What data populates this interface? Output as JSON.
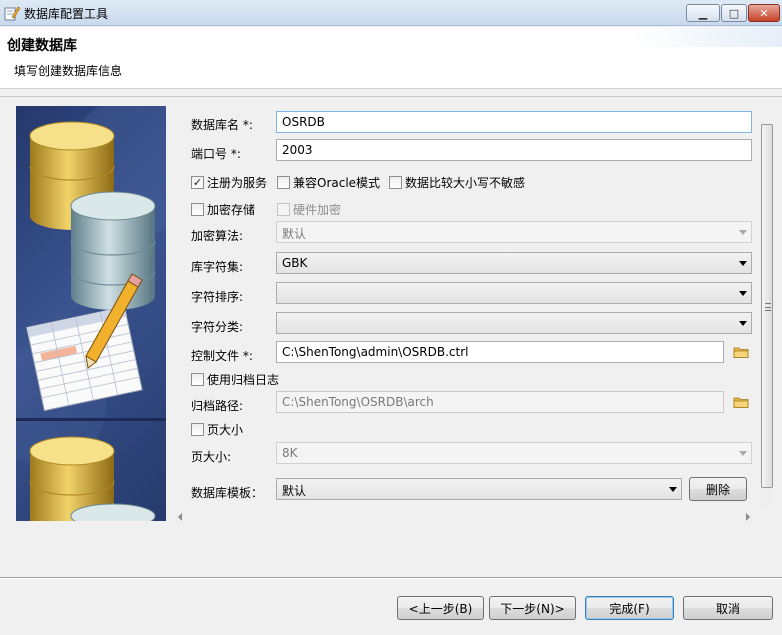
{
  "window": {
    "title": "数据库配置工具",
    "controls": {
      "minimize": "▁",
      "maximize": "□",
      "close": "✕"
    }
  },
  "header": {
    "title": "创建数据库",
    "subtitle": "填写创建数据库信息"
  },
  "form": {
    "db_name": {
      "label": "数据库名 *:",
      "value": "OSRDB"
    },
    "port": {
      "label": "端口号 *:",
      "value": "2003"
    },
    "register_service": {
      "label": "注册为服务",
      "checked": true
    },
    "oracle_mode": {
      "label": "兼容Oracle模式",
      "checked": false
    },
    "case_insensitive": {
      "label": "数据比较大小写不敏感",
      "checked": false
    },
    "encrypt_storage": {
      "label": "加密存储",
      "checked": false
    },
    "hardware_encrypt": {
      "label": "硬件加密",
      "checked": false
    },
    "encrypt_algorithm": {
      "label": "加密算法:",
      "value": "默认"
    },
    "charset": {
      "label": "库字符集:",
      "value": "GBK"
    },
    "collation": {
      "label": "字符排序:",
      "value": ""
    },
    "char_class": {
      "label": "字符分类:",
      "value": ""
    },
    "control_file": {
      "label": "控制文件 *:",
      "value": "C:\\ShenTong\\admin\\OSRDB.ctrl"
    },
    "use_archive_log": {
      "label": "使用归档日志",
      "checked": false
    },
    "archive_path": {
      "label": "归档路径:",
      "value": "C:\\ShenTong\\OSRDB\\arch"
    },
    "page_size_check": {
      "label": "页大小",
      "checked": false
    },
    "page_size": {
      "label": "页大小:",
      "value": "8K"
    },
    "template": {
      "label": "数据库模板：",
      "value": "默认",
      "delete_label": "删除"
    }
  },
  "footer": {
    "prev": "<上一步(B)",
    "next": "下一步(N)>",
    "finish": "完成(F)",
    "cancel": "取消"
  },
  "icons": {
    "folder_color": "#e8b84a",
    "check_mark": "✓"
  }
}
